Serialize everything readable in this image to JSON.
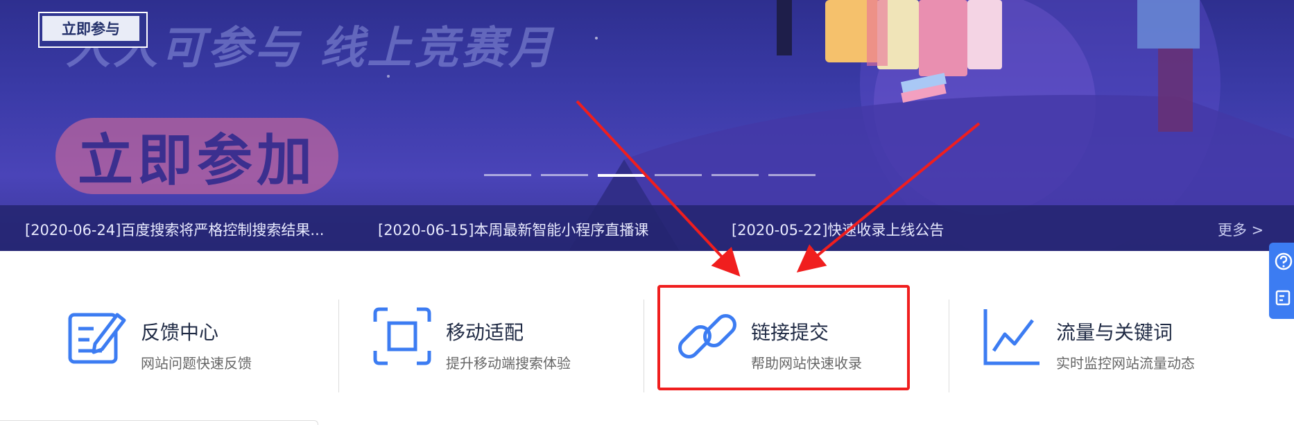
{
  "banner": {
    "pill_label": "立即参与",
    "slogan": "人人可参与 线上竞赛月",
    "join_label": "立即参加",
    "carousel_active_index": 2,
    "carousel_count": 6
  },
  "news": {
    "items": [
      "[2020-06-24]百度搜索将严格控制搜索结果...",
      "[2020-06-15]本周最新智能小程序直播课",
      "[2020-05-22]快速收录上线公告"
    ],
    "more": "更多 >"
  },
  "features": [
    {
      "title": "反馈中心",
      "desc": "网站问题快速反馈",
      "icon": "feedback-edit-icon"
    },
    {
      "title": "移动适配",
      "desc": "提升移动端搜索体验",
      "icon": "mobile-adapt-icon"
    },
    {
      "title": "链接提交",
      "desc": "帮助网站快速收录",
      "icon": "link-chain-icon"
    },
    {
      "title": "流量与关键词",
      "desc": "实时监控网站流量动态",
      "icon": "trend-chart-icon"
    }
  ],
  "sidebar": {
    "icons": [
      "help-question-icon",
      "edit-note-icon"
    ]
  },
  "colors": {
    "accent": "#3c7cf2",
    "highlight": "#f01e1e",
    "banner": "#3a3aa6"
  }
}
